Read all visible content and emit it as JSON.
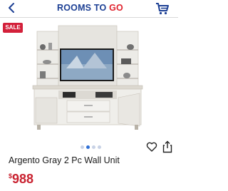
{
  "header": {
    "logo_text_main": "ROOMS TO ",
    "logo_text_accent": "GO",
    "brand_blue": "#1c3f94",
    "brand_red": "#e0232e"
  },
  "product": {
    "badge": "SALE",
    "title": "Argento Gray 2 Pc Wall Unit",
    "price_currency": "$",
    "price_amount": "988",
    "price_color": "#c9212f"
  },
  "gallery": {
    "image_count": 4,
    "active_index": 1
  },
  "icons": [
    "back-icon",
    "cart-icon",
    "heart-icon",
    "share-icon"
  ]
}
